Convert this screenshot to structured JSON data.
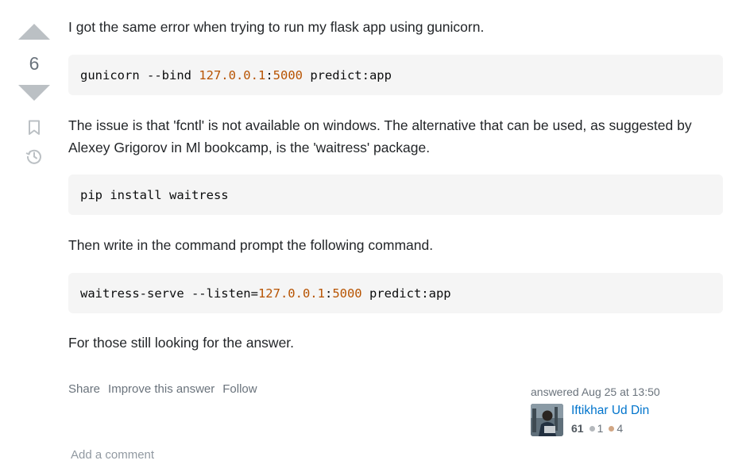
{
  "vote": {
    "count": "6"
  },
  "post": {
    "intro": "I got the same error when trying to run my flask app using gunicorn.",
    "code1": {
      "pre": "gunicorn --bind ",
      "ip": "127.0.0.1",
      "colon": ":",
      "port": "5000",
      "post": " predict:app"
    },
    "para2": "The issue is that 'fcntl' is not available on windows. The alternative that can be used, as suggested by Alexey Grigorov in Ml bookcamp, is the 'waitress' package.",
    "code2": "pip install waitress",
    "para3": "Then write in the command prompt the following command.",
    "code3": {
      "pre": "waitress-serve --listen=",
      "ip": "127.0.0.1",
      "colon": ":",
      "port": "5000",
      "post": " predict:app"
    },
    "para4": "For those still looking for the answer."
  },
  "actions": {
    "share": "Share",
    "improve": "Improve this answer",
    "follow": "Follow"
  },
  "signature": {
    "answered": "answered Aug 25 at 13:50",
    "user_name": "Iftikhar Ud Din",
    "reputation": "61",
    "silver_badges": "1",
    "bronze_badges": "4"
  },
  "add_comment": "Add a comment",
  "colors": {
    "link": "#0074cc",
    "code_number": "#b75301",
    "muted": "#6a737c"
  }
}
